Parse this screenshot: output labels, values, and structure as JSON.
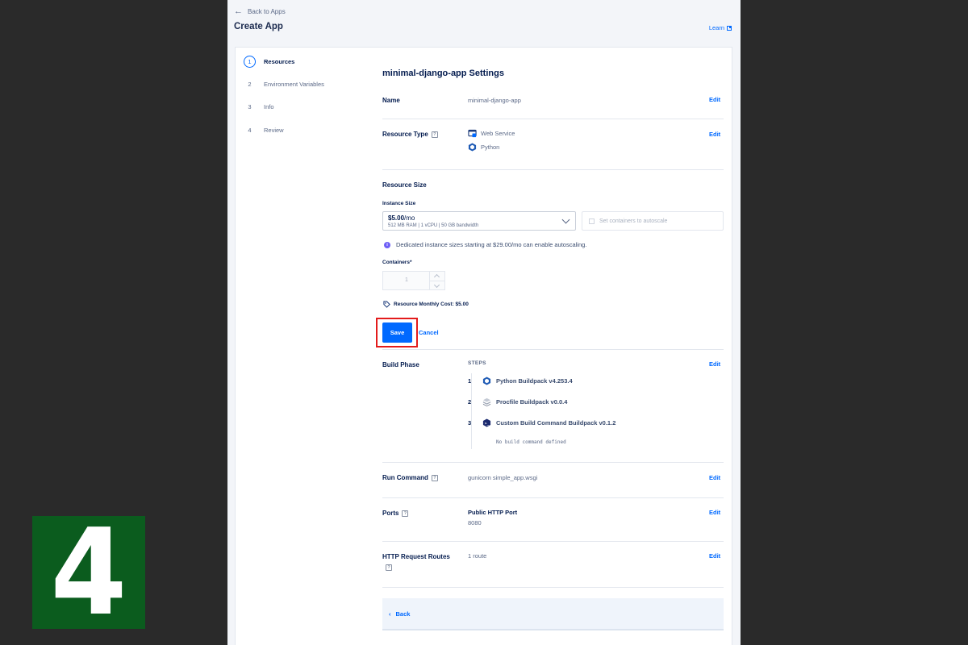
{
  "header": {
    "back_label": "Back to Apps",
    "title": "Create App",
    "learn_label": "Learn"
  },
  "steps": [
    {
      "num": "1",
      "label": "Resources"
    },
    {
      "num": "2",
      "label": "Environment Variables"
    },
    {
      "num": "3",
      "label": "Info"
    },
    {
      "num": "4",
      "label": "Review"
    }
  ],
  "settings": {
    "title": "minimal-django-app Settings",
    "edit_label": "Edit",
    "name": {
      "label": "Name",
      "value": "minimal-django-app"
    },
    "resource_type": {
      "label": "Resource Type",
      "items": [
        "Web Service",
        "Python"
      ]
    }
  },
  "resource_size": {
    "title": "Resource Size",
    "instance_size_label": "Instance Size",
    "instance_price": "$5.00",
    "instance_price_unit": "/mo",
    "instance_spec": "512 MB RAM | 1 vCPU | 50 GB bandwidth",
    "autoscale_label": "Set containers to autoscale",
    "info_note": "Dedicated instance sizes starting at $29.00/mo can enable autoscaling.",
    "containers_label": "Containers*",
    "containers_value": "1",
    "monthly_cost": "Resource Monthly Cost: $5.00",
    "save_label": "Save",
    "cancel_label": "Cancel"
  },
  "build_phase": {
    "label": "Build Phase",
    "steps_header": "STEPS",
    "steps": [
      {
        "num": "1",
        "name": "Python Buildpack v4.253.4"
      },
      {
        "num": "2",
        "name": "Procfile Buildpack v0.0.4"
      },
      {
        "num": "3",
        "name": "Custom Build Command Buildpack v0.1.2"
      }
    ],
    "no_build_command": "No build command defined"
  },
  "run_command": {
    "label": "Run Command",
    "value": "gunicorn simple_app.wsgi"
  },
  "ports": {
    "label": "Ports",
    "title": "Public HTTP Port",
    "value": "8080"
  },
  "http_routes": {
    "label": "HTTP Request Routes",
    "value": "1 route"
  },
  "footer": {
    "back_label": "Back"
  },
  "overlay": {
    "step_number": "4"
  },
  "colors": {
    "accent": "#0069ff",
    "highlight": "#e31b1b",
    "badge": "#0b5c1e"
  }
}
